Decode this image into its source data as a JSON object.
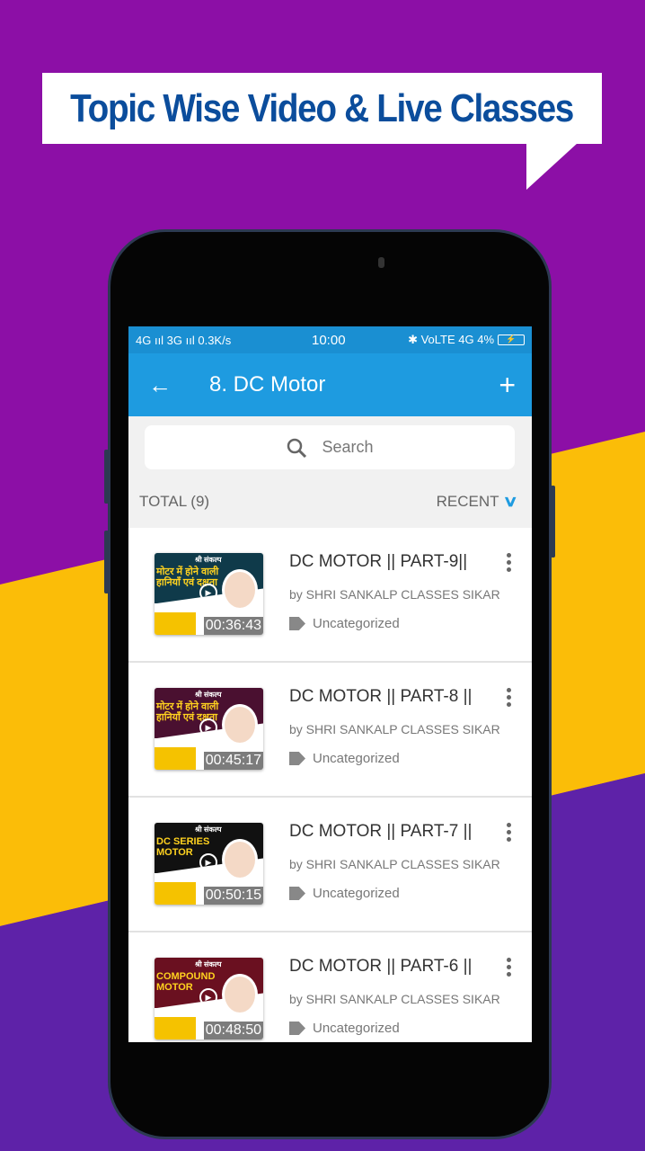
{
  "banner": {
    "text": "Topic Wise Video & Live Classes"
  },
  "status_bar": {
    "left": "4G ııl  3G ııl  0.3K/s",
    "time": "10:00",
    "right": "✱ VoLTE 4G 4%",
    "battery": "⚡"
  },
  "app_bar": {
    "back_icon": "arrow-left-icon",
    "title": "8. DC Motor",
    "add_icon": "plus-icon"
  },
  "search": {
    "placeholder": "Search"
  },
  "list_header": {
    "total": "TOTAL (9)",
    "sort": "RECENT"
  },
  "colors": {
    "primary": "#1e9be0",
    "background": "#8c0fa6",
    "accent": "#fbbd08",
    "banner_text": "#0b4d9c"
  },
  "videos": [
    {
      "title": "DC MOTOR || PART-9||",
      "author": "by SHRI SANKALP CLASSES SIKAR",
      "category": "Uncategorized",
      "duration": "00:36:43",
      "thumb_caption": "मोटर में होने वाली हानियाँ एवं दक्षता",
      "thumb_brand": "श्री संकल्प",
      "thumb_color": "#0f3a4a"
    },
    {
      "title": "DC MOTOR || PART-8 ||",
      "author": "by SHRI SANKALP CLASSES SIKAR",
      "category": "Uncategorized",
      "duration": "00:45:17",
      "thumb_caption": "मोटर में होने वाली हानियाँ एवं दक्षता",
      "thumb_brand": "श्री संकल्प",
      "thumb_color": "#4a1030"
    },
    {
      "title": "DC MOTOR || PART-7 ||",
      "author": "by SHRI SANKALP CLASSES SIKAR",
      "category": "Uncategorized",
      "duration": "00:50:15",
      "thumb_caption": "DC SERIES MOTOR",
      "thumb_brand": "श्री संकल्प",
      "thumb_color": "#111111"
    },
    {
      "title": "DC MOTOR || PART-6 ||",
      "author": "by SHRI SANKALP CLASSES SIKAR",
      "category": "Uncategorized",
      "duration": "00:48:50",
      "thumb_caption": "COMPOUND MOTOR",
      "thumb_brand": "श्री संकल्प",
      "thumb_color": "#6a1020"
    }
  ]
}
